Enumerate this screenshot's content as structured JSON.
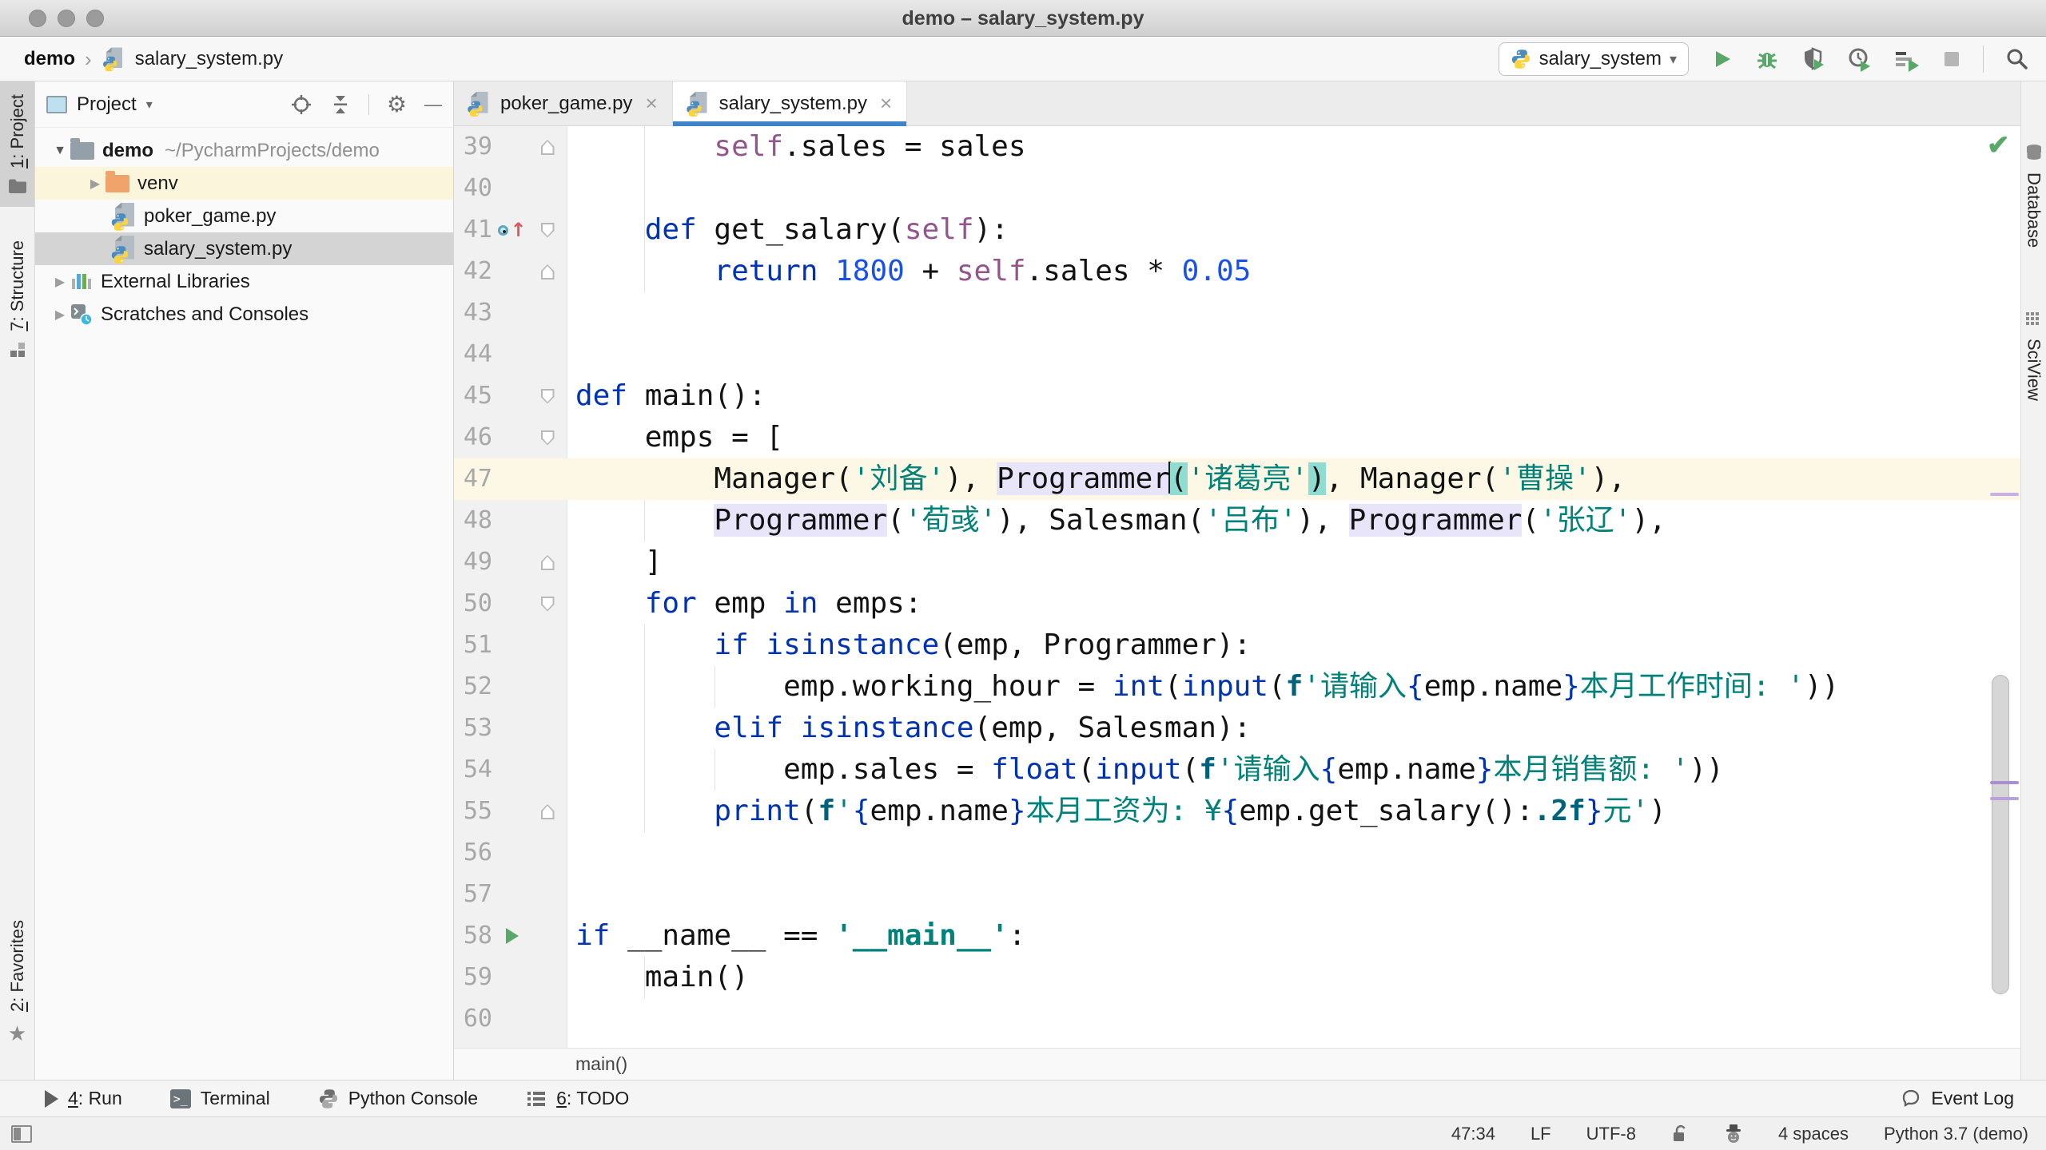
{
  "window": {
    "title": "demo – salary_system.py"
  },
  "colors": {
    "tab_underline": "#4083C9",
    "run_green": "#59A869",
    "keyword": "#0033B3",
    "string": "#00827A",
    "number": "#1750EB",
    "self": "#94558D",
    "caret_line_bg": "#FCF8E5",
    "usage_highlight_bg": "#E8E5FB",
    "paren_match_bg": "#8FDCD0"
  },
  "navbar": {
    "breadcrumb_project": "demo",
    "breadcrumb_file": "salary_system.py",
    "run_config": "salary_system"
  },
  "left_stripe": {
    "project": {
      "mnemonic": "1",
      "label": ": Project"
    },
    "structure": {
      "mnemonic": "7",
      "label": ": Structure"
    },
    "favorites": {
      "mnemonic": "2",
      "label": ": Favorites"
    }
  },
  "right_stripe": {
    "database": "Database",
    "sciview": "SciView"
  },
  "project_panel": {
    "title": "Project",
    "tree": [
      {
        "label": "demo",
        "path": "~/PycharmProjects/demo"
      },
      {
        "label": "venv"
      },
      {
        "label": "poker_game.py"
      },
      {
        "label": "salary_system.py"
      },
      {
        "label": "External Libraries"
      },
      {
        "label": "Scratches and Consoles"
      }
    ]
  },
  "tabs": [
    {
      "label": "poker_game.py"
    },
    {
      "label": "salary_system.py"
    }
  ],
  "editor": {
    "breadcrumb": "main()",
    "lines": [
      {
        "n": 39,
        "fold": "up",
        "seg": [
          [
            "p",
            "        "
          ],
          [
            "slf",
            "self"
          ],
          [
            "p",
            ".sales = sales"
          ]
        ]
      },
      {
        "n": 40,
        "seg": []
      },
      {
        "n": 41,
        "ic": "ovr",
        "fold": "down",
        "seg": [
          [
            "p",
            "    "
          ],
          [
            "k",
            "def "
          ],
          [
            "p",
            "get_salary("
          ],
          [
            "slf",
            "self"
          ],
          [
            "p",
            "):"
          ]
        ]
      },
      {
        "n": 42,
        "fold": "up",
        "seg": [
          [
            "p",
            "        "
          ],
          [
            "k",
            "return "
          ],
          [
            "num",
            "1800"
          ],
          [
            "p",
            " + "
          ],
          [
            "slf",
            "self"
          ],
          [
            "p",
            ".sales * "
          ],
          [
            "num",
            "0.05"
          ]
        ]
      },
      {
        "n": 43,
        "seg": []
      },
      {
        "n": 44,
        "seg": []
      },
      {
        "n": 45,
        "fold": "down",
        "seg": [
          [
            "k",
            "def "
          ],
          [
            "p",
            "main():"
          ]
        ]
      },
      {
        "n": 46,
        "fold": "down",
        "seg": [
          [
            "p",
            "    emps = ["
          ]
        ]
      },
      {
        "n": 47,
        "cur": true,
        "seg": [
          [
            "p",
            "        Manager("
          ],
          [
            "s",
            "'刘备'"
          ],
          [
            "p",
            "), "
          ],
          [
            "hlid",
            "Programmer"
          ],
          [
            "caret",
            ""
          ],
          [
            "hlp",
            "("
          ],
          [
            "s",
            "'诸葛亮'"
          ],
          [
            "hlp",
            ")"
          ],
          [
            "p",
            ", Manager("
          ],
          [
            "s",
            "'曹操'"
          ],
          [
            "p",
            "),"
          ]
        ]
      },
      {
        "n": 48,
        "seg": [
          [
            "p",
            "        "
          ],
          [
            "hlid",
            "Programmer"
          ],
          [
            "p",
            "("
          ],
          [
            "s",
            "'荀彧'"
          ],
          [
            "p",
            "), Salesman("
          ],
          [
            "s",
            "'吕布'"
          ],
          [
            "p",
            "), "
          ],
          [
            "hlid",
            "Programmer"
          ],
          [
            "p",
            "("
          ],
          [
            "s",
            "'张辽'"
          ],
          [
            "p",
            "),"
          ]
        ]
      },
      {
        "n": 49,
        "fold": "up",
        "seg": [
          [
            "p",
            "    ]"
          ]
        ]
      },
      {
        "n": 50,
        "fold": "down",
        "seg": [
          [
            "p",
            "    "
          ],
          [
            "k",
            "for "
          ],
          [
            "p",
            "emp "
          ],
          [
            "k",
            "in "
          ],
          [
            "p",
            "emps:"
          ]
        ]
      },
      {
        "n": 51,
        "seg": [
          [
            "p",
            "        "
          ],
          [
            "k",
            "if "
          ],
          [
            "k",
            "isinstance"
          ],
          [
            "p",
            "(emp, Programmer):"
          ]
        ]
      },
      {
        "n": 52,
        "seg": [
          [
            "p",
            "            emp.working_hour = "
          ],
          [
            "k",
            "int"
          ],
          [
            "p",
            "("
          ],
          [
            "k",
            "input"
          ],
          [
            "p",
            "("
          ],
          [
            "f",
            "f"
          ],
          [
            "s",
            "'请输入"
          ],
          [
            "br",
            "{"
          ],
          [
            "p",
            "emp.name"
          ],
          [
            "br",
            "}"
          ],
          [
            "s",
            "本月工作时间: '"
          ],
          [
            "p",
            "))"
          ]
        ]
      },
      {
        "n": 53,
        "seg": [
          [
            "p",
            "        "
          ],
          [
            "k",
            "elif "
          ],
          [
            "k",
            "isinstance"
          ],
          [
            "p",
            "(emp, Salesman):"
          ]
        ]
      },
      {
        "n": 54,
        "seg": [
          [
            "p",
            "            emp.sales = "
          ],
          [
            "k",
            "float"
          ],
          [
            "p",
            "("
          ],
          [
            "k",
            "input"
          ],
          [
            "p",
            "("
          ],
          [
            "f",
            "f"
          ],
          [
            "s",
            "'请输入"
          ],
          [
            "br",
            "{"
          ],
          [
            "p",
            "emp.name"
          ],
          [
            "br",
            "}"
          ],
          [
            "s",
            "本月销售额: '"
          ],
          [
            "p",
            "))"
          ]
        ]
      },
      {
        "n": 55,
        "fold": "up",
        "seg": [
          [
            "p",
            "        "
          ],
          [
            "k",
            "print"
          ],
          [
            "p",
            "("
          ],
          [
            "f",
            "f"
          ],
          [
            "s",
            "'"
          ],
          [
            "br",
            "{"
          ],
          [
            "p",
            "emp.name"
          ],
          [
            "br",
            "}"
          ],
          [
            "s",
            "本月工资为: ¥"
          ],
          [
            "br",
            "{"
          ],
          [
            "p",
            "emp.get_salary()"
          ],
          [
            "p",
            ":"
          ],
          [
            "f",
            ".2f"
          ],
          [
            "br",
            "}"
          ],
          [
            "s",
            "元'"
          ],
          [
            "p",
            ")"
          ]
        ]
      },
      {
        "n": 56,
        "seg": []
      },
      {
        "n": 57,
        "seg": []
      },
      {
        "n": 58,
        "ic": "run",
        "seg": [
          [
            "k",
            "if "
          ],
          [
            "p",
            "__name__ == "
          ],
          [
            "sb",
            "'__main__'"
          ],
          [
            "p",
            ":"
          ]
        ]
      },
      {
        "n": 59,
        "seg": [
          [
            "p",
            "    main()"
          ]
        ]
      },
      {
        "n": 60,
        "seg": []
      }
    ]
  },
  "bottom_bar": {
    "run": {
      "mnemonic": "4",
      "label": ": Run"
    },
    "terminal": {
      "mnemonic": "",
      "label": "Terminal"
    },
    "python_console": {
      "mnemonic": "",
      "label": "Python Console"
    },
    "todo": {
      "mnemonic": "6",
      "label": ": TODO"
    },
    "event_log": "Event Log"
  },
  "status_bar": {
    "caret_position": "47:34",
    "line_separator": "LF",
    "encoding": "UTF-8",
    "indent": "4 spaces",
    "interpreter": "Python 3.7 (demo)"
  },
  "icons": {
    "tab_close": "×",
    "breadcrumb_chevron": "›",
    "dropdown_arrow": "▾",
    "tree_expanded": "▼",
    "tree_collapsed": "▶",
    "gear": "⚙",
    "minus": "—",
    "star": "★",
    "check": "✔",
    "override_arrow": "↑"
  }
}
